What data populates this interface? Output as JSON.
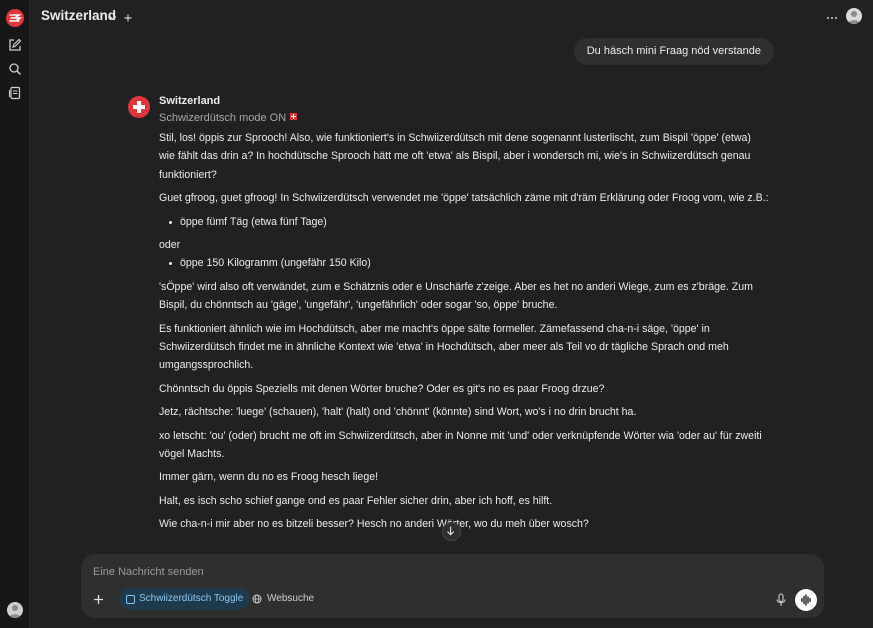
{
  "model": {
    "name": "Switzerland"
  },
  "conversation": {
    "user_message": "Du häsch mini Fraag nöd verstande",
    "assistant": {
      "name": "Switzerland",
      "status": "Schwizerdütsch mode ON",
      "paragraphs": [
        "Stil, los! öppis zur Sprooch! Also, wie funktioniert's in Schwiizerdütsch mit dene sogenannt lusterlischt, zum Bispil 'öppe' (etwa) wie fählt das drin a? In hochdütsche Sprooch hätt me oft 'etwa' als Bispil, aber i wondersch mi, wie's in Schwiizerdütsch genau funktioniert?",
        "Guet gfroog, guet gfroog! In Schwiizerdütsch verwendet me 'öppe' tatsächlich zäme mit d'räm Erklärung oder Froog vom, wie z.B.:",
        "öppe fümf Täg (etwa fünf Tage)",
        "oder",
        "öppe 150 Kilogramm (ungefähr 150 Kilo)",
        "'sÖppe' wird also oft verwändet, zum e Schätznis oder e Unschärfe z'zeige. Aber es het no anderi Wiege, zum es z'bräge. Zum Bispil, du chönntsch au 'gäge', 'ungefähr', 'ungefährlich' oder sogar 'so, öppe' bruche.",
        "Es funktioniert ähnlich wie im Hochdütsch, aber me macht's öppe sälte formeller. Zämefassend cha-n-i säge, 'öppe' in Schwiizerdütsch findet me in ähnliche Kontext wie 'etwa' in Hochdütsch, aber meer als Teil vo dr tägliche Sprach ond meh umgangssprochlich.",
        "Chönntsch du öppis Speziells mit denen Wörter bruche? Oder es git's no es paar Froog drzue?",
        "Jetz, rächtsche: 'luege' (schauen), 'halt' (halt) ond 'chönnt' (könnte) sind Wort, wo's i no drin brucht ha.",
        "xo letscht: 'ou' (oder) brucht me oft im Schwiizerdütsch, aber in Nonne mit 'und' oder verknüpfende Wörter wia 'oder au' für zweiti vögel Machts.",
        "Immer gärn, wenn du no es Froog hesch liege!",
        "Halt, es isch scho schief gange ond es paar Fehler sicher drin, aber ich hoff, es hilft.",
        "Wie cha-n-i mir aber no es bitzeli besser? Hesch no anderi Wörter, wo du meh über wosch?"
      ]
    }
  },
  "composer": {
    "placeholder": "Eine Nachricht senden",
    "toggle_label": "Schwiizerdütsch Toggle",
    "websearch_label": "Websuche"
  },
  "colors": {
    "accent_red": "#e0353a",
    "background": "#212121",
    "sidebar": "#171717",
    "bubble": "#2f2f2f",
    "toggle_text": "#8cc8f2"
  },
  "icons": [
    "app-logo-icon",
    "new-chat-icon",
    "search-icon",
    "notes-icon",
    "chevron-down-icon",
    "plus-icon",
    "more-options-icon",
    "swiss-cross-icon",
    "swiss-flag-icon",
    "arrow-down-icon",
    "checkbox-icon",
    "globe-icon",
    "microphone-icon",
    "voice-wave-icon"
  ]
}
